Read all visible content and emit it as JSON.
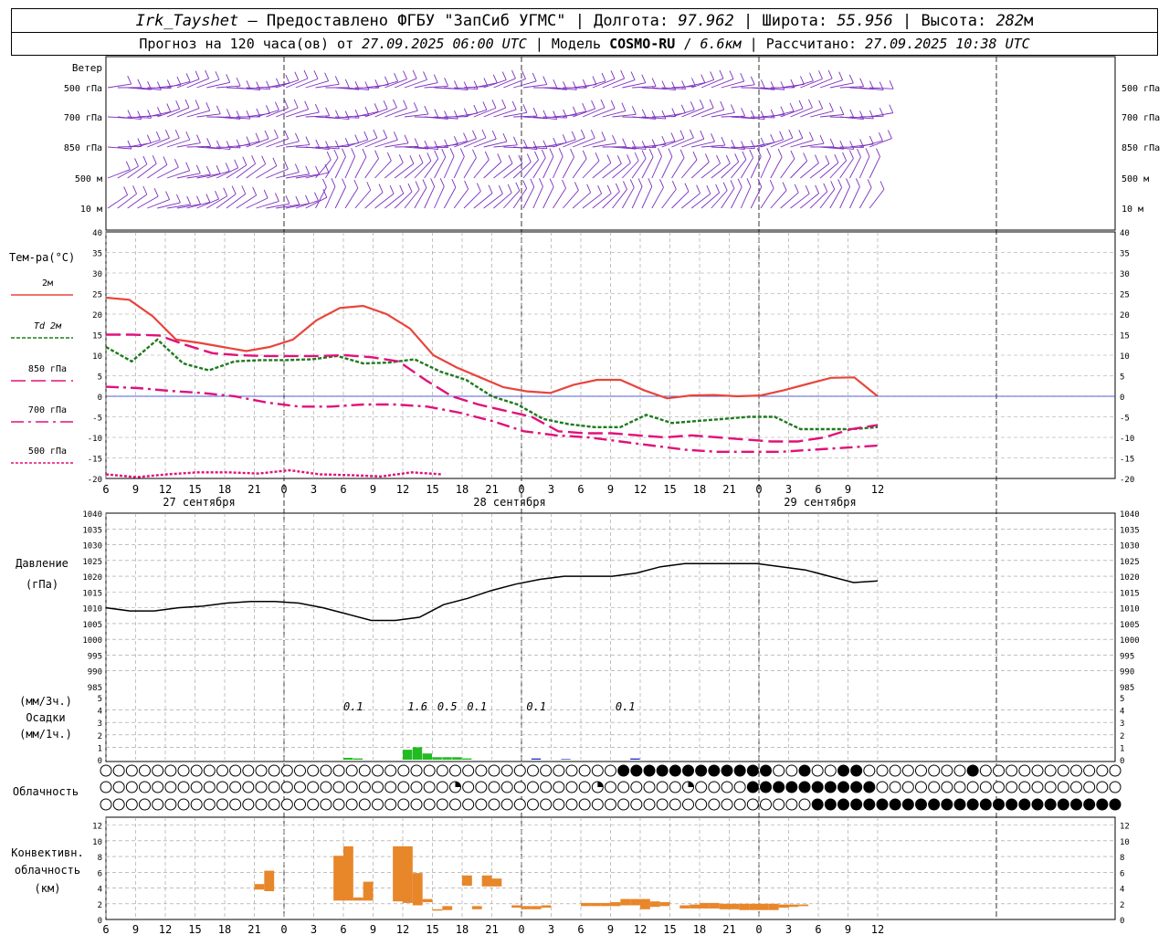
{
  "header": {
    "station": "Irk_Tayshet",
    "provider": "Предоставлено ФГБУ \"ЗапСиб УГМС\"",
    "lon_label": "Долгота:",
    "lon_value": "97.962",
    "lat_label": "Широта:",
    "lat_value": "55.956",
    "alt_label": "Высота:",
    "alt_value": "282",
    "alt_unit": "м",
    "forecast_prefix": "Прогноз на 120 часа(ов) от",
    "init_time": "27.09.2025 06:00 UTC",
    "model_label": "Модель",
    "model_name": "COSMO-RU",
    "model_res": "6.6км",
    "computed_label": "Рассчитано:",
    "computed_time": "27.09.2025 10:38 UTC"
  },
  "chart_data": [
    {
      "type": "line",
      "panel": "wind",
      "title": "Ветер",
      "levels": [
        "500 гПа",
        "700 гПа",
        "850 гПа",
        "500 м",
        "10 м"
      ],
      "color": "#7b2fbf"
    },
    {
      "type": "line",
      "panel": "temperature",
      "ylabel": "Тем-ра(°С)",
      "ylim": [
        -20,
        40
      ],
      "yticks": [
        -20,
        -15,
        -10,
        -5,
        0,
        5,
        10,
        15,
        20,
        25,
        30,
        35,
        40
      ],
      "x_hours": [
        0,
        3,
        6,
        9,
        12,
        15,
        18,
        21,
        24,
        27,
        30,
        33,
        36,
        39,
        42,
        45,
        48,
        51,
        54,
        57,
        60,
        63,
        66,
        69,
        72,
        75,
        78
      ],
      "series": [
        {
          "name": "2м",
          "color": "#e8453c",
          "values": [
            24,
            23.5,
            19.5,
            13.8,
            13,
            12,
            11,
            12,
            13.8,
            18.5,
            21.5,
            22,
            20,
            16.5,
            10,
            7,
            4.6,
            2.2,
            1.2,
            0.8,
            2.8,
            4,
            4,
            1.5,
            -0.5,
            0.2,
            0.3,
            0,
            0.2,
            1.5,
            3,
            4.5,
            4.6,
            0
          ]
        },
        {
          "name": "Td 2м",
          "color": "#1e7a1e",
          "values": [
            12,
            8.5,
            13.8,
            8,
            6.3,
            8.5,
            8.8,
            8.8,
            9,
            9.8,
            8,
            8.2,
            9,
            6,
            4,
            0,
            -2,
            -5.5,
            -6.8,
            -7.5,
            -7.5,
            -4.5,
            -6.5,
            -6,
            -5.5,
            -5,
            -5,
            -8,
            -8,
            -8,
            -7.5
          ]
        },
        {
          "name": "850 гПа",
          "color": "#e0117a",
          "values": [
            15,
            15,
            14.8,
            12.5,
            10.5,
            10,
            9.8,
            9.8,
            9.8,
            10,
            9.5,
            8.5,
            4,
            0,
            -2,
            -3.5,
            -5,
            -8.5,
            -9,
            -9,
            -9.5,
            -10,
            -9.5,
            -10,
            -10.5,
            -11,
            -11,
            -10,
            -8,
            -7
          ]
        },
        {
          "name": "700 гПа",
          "color": "#e0117a",
          "values": [
            2.3,
            2,
            1.3,
            0.8,
            0,
            -1.5,
            -2.5,
            -2.5,
            -2,
            -2,
            -2.5,
            -4,
            -6,
            -8.5,
            -9.5,
            -10,
            -11,
            -12,
            -13,
            -13.5,
            -13.5,
            -13.5,
            -13,
            -12.5,
            -12
          ]
        },
        {
          "name": "500 гПа",
          "color": "#e0117a",
          "values": [
            -19,
            -19.7,
            -19,
            -18.5,
            -18.5,
            -18.8,
            -18,
            -19,
            -19.2,
            -19.5,
            -18.5,
            -19
          ]
        }
      ]
    },
    {
      "type": "line",
      "panel": "pressure",
      "ylabel": "Давление",
      "yunit": "(гПа)",
      "ylim": [
        985,
        1040
      ],
      "yticks": [
        985,
        990,
        995,
        1000,
        1005,
        1010,
        1015,
        1020,
        1025,
        1030,
        1035,
        1040
      ],
      "series": [
        {
          "name": "",
          "color": "#000000",
          "values": [
            1010,
            1009,
            1009,
            1010,
            1010.5,
            1011.5,
            1012,
            1012,
            1011.5,
            1010,
            1008,
            1006,
            1006,
            1007,
            1011,
            1013,
            1015.5,
            1017.5,
            1019,
            1020,
            1020,
            1020,
            1021,
            1023,
            1024,
            1024,
            1024,
            1024,
            1023,
            1022,
            1020,
            1018,
            1018.5
          ]
        }
      ]
    },
    {
      "type": "bar",
      "panel": "precipitation",
      "ylabel": "Осадки",
      "yunit_top": "(мм/3ч.)",
      "yunit_bottom": "(мм/1ч.)",
      "ylim": [
        0,
        5
      ],
      "yticks": [
        0,
        1,
        2,
        3,
        4,
        5
      ],
      "labels": [
        "0.1",
        "1.6",
        "0.5",
        "0.1",
        "0.1",
        "0.1"
      ],
      "colors": {
        "rain": "#22bb22",
        "snow": "#2233cc"
      },
      "rain_hourly": [
        {
          "h": 24,
          "v": 0.15
        },
        {
          "h": 25,
          "v": 0.1
        },
        {
          "h": 30,
          "v": 0.8
        },
        {
          "h": 31,
          "v": 1.0
        },
        {
          "h": 32,
          "v": 0.5
        },
        {
          "h": 33,
          "v": 0.2
        },
        {
          "h": 34,
          "v": 0.2
        },
        {
          "h": 35,
          "v": 0.2
        },
        {
          "h": 36,
          "v": 0.1
        }
      ],
      "snow_hourly": [
        {
          "h": 43,
          "v": 0.1
        },
        {
          "h": 46,
          "v": 0.05
        },
        {
          "h": 53,
          "v": 0.1
        }
      ]
    },
    {
      "type": "table",
      "panel": "cloudiness",
      "title": "Облачность",
      "rows": 3,
      "note": "cloud cover symbols, one per hour: 0 clear, 1 quarter, 2 half, 3 three-quarter, 4 overcast"
    },
    {
      "type": "bar",
      "panel": "convective",
      "ylabel": [
        "Конвективн.",
        "облачность",
        "(км)"
      ],
      "ylim": [
        0,
        13
      ],
      "yticks": [
        0,
        2,
        4,
        6,
        8,
        10,
        12
      ],
      "color": "#e8862a",
      "bars": [
        {
          "h": 15.5,
          "b": 3.8,
          "t": 4.5
        },
        {
          "h": 16.5,
          "b": 3.6,
          "t": 6.2
        },
        {
          "h": 23.5,
          "b": 2.4,
          "t": 8.1
        },
        {
          "h": 24.5,
          "b": 2.4,
          "t": 9.3
        },
        {
          "h": 25.5,
          "b": 2.4,
          "t": 2.8
        },
        {
          "h": 26.5,
          "b": 2.4,
          "t": 4.8
        },
        {
          "h": 29.5,
          "b": 2.3,
          "t": 9.3
        },
        {
          "h": 30.5,
          "b": 2.1,
          "t": 9.3
        },
        {
          "h": 31.5,
          "b": 1.8,
          "t": 5.9
        },
        {
          "h": 32.5,
          "b": 2.2,
          "t": 2.6
        },
        {
          "h": 33.5,
          "b": 1.2,
          "t": 1.3
        },
        {
          "h": 34.5,
          "b": 1.2,
          "t": 1.7
        },
        {
          "h": 36.5,
          "b": 4.3,
          "t": 5.6
        },
        {
          "h": 37.5,
          "b": 1.3,
          "t": 1.7
        },
        {
          "h": 38.5,
          "b": 4.2,
          "t": 5.6
        },
        {
          "h": 39.5,
          "b": 4.2,
          "t": 5.2
        },
        {
          "h": 41.5,
          "b": 1.5,
          "t": 1.8
        },
        {
          "h": 42.5,
          "b": 1.3,
          "t": 1.7
        },
        {
          "h": 43.5,
          "b": 1.3,
          "t": 1.7
        },
        {
          "h": 44.5,
          "b": 1.5,
          "t": 1.8
        },
        {
          "h": 48.5,
          "b": 1.7,
          "t": 2.1
        },
        {
          "h": 49.5,
          "b": 1.7,
          "t": 2.1
        },
        {
          "h": 50.5,
          "b": 1.7,
          "t": 2.1
        },
        {
          "h": 51.5,
          "b": 1.7,
          "t": 2.2
        },
        {
          "h": 52.5,
          "b": 1.8,
          "t": 2.6
        },
        {
          "h": 53.5,
          "b": 1.8,
          "t": 2.6
        },
        {
          "h": 54.5,
          "b": 1.3,
          "t": 2.6
        },
        {
          "h": 55.5,
          "b": 1.6,
          "t": 2.3
        },
        {
          "h": 56.5,
          "b": 1.7,
          "t": 2.2
        },
        {
          "h": 58.5,
          "b": 1.4,
          "t": 1.8
        },
        {
          "h": 59.5,
          "b": 1.4,
          "t": 1.9
        },
        {
          "h": 60.5,
          "b": 1.4,
          "t": 2.1
        },
        {
          "h": 61.5,
          "b": 1.4,
          "t": 2.1
        },
        {
          "h": 62.5,
          "b": 1.3,
          "t": 2.0
        },
        {
          "h": 63.5,
          "b": 1.3,
          "t": 2.0
        },
        {
          "h": 64.5,
          "b": 1.2,
          "t": 2.0
        },
        {
          "h": 65.5,
          "b": 1.2,
          "t": 2.0
        },
        {
          "h": 66.5,
          "b": 1.2,
          "t": 2.0
        },
        {
          "h": 67.5,
          "b": 1.2,
          "t": 2.0
        },
        {
          "h": 68.5,
          "b": 1.5,
          "t": 1.9
        },
        {
          "h": 69.5,
          "b": 1.6,
          "t": 1.9
        },
        {
          "h": 70.5,
          "b": 1.7,
          "t": 1.9
        }
      ]
    }
  ],
  "x_axis": {
    "hour_labels": [
      "6",
      "9",
      "12",
      "15",
      "18",
      "21",
      "0",
      "3",
      "6",
      "9",
      "12",
      "15",
      "18",
      "21",
      "0",
      "3",
      "6",
      "9",
      "12",
      "15",
      "18",
      "21",
      "0",
      "3",
      "6",
      "9",
      "12"
    ],
    "dates": [
      "27 сентября",
      "28 сентября",
      "29 сентября"
    ]
  },
  "cloud_rows": [
    "0000000000000000000000000000000000000000444444444444004004400000000400000000000000000000000000000000000000000000000000000000",
    "0000000000000000000000000001000000000010000001000044444444440000000000000000000000000000000000000000000000000000000000000000",
    "0000000000000000000000000000000000000000000000000000000444444444444444444444444444444444444444444444444444444444442000000000"
  ]
}
